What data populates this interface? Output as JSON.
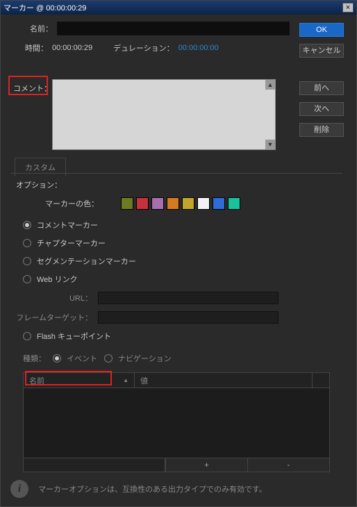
{
  "titlebar": {
    "text": "マーカー @ 00:00:00:29",
    "close": "×"
  },
  "buttons": {
    "ok": "OK",
    "cancel": "キャンセル",
    "prev": "前へ",
    "next": "次へ",
    "delete": "削除"
  },
  "fields": {
    "name_label": "名前：",
    "time_label": "時間：",
    "time_value": "00:00:00:29",
    "duration_label": "デュレーション：",
    "duration_value": "00:00:00:00",
    "comment_label": "コメント："
  },
  "tab": {
    "custom": "カスタム"
  },
  "options": {
    "header": "オプション：",
    "marker_color_label": "マーカーの色：",
    "colors": [
      "#6c7a22",
      "#c8303a",
      "#a86eb0",
      "#d67a22",
      "#c2a52a",
      "#f2f2f2",
      "#2e6cd8",
      "#18c29b"
    ],
    "types": {
      "comment": "コメントマーカー",
      "chapter": "チャプターマーカー",
      "segmentation": "セグメンテーションマーカー",
      "weblink": "Web リンク"
    },
    "url_label": "URL：",
    "frame_target_label": "フレームターゲット：",
    "flash_cue": "Flash キューポイント",
    "kind_label": "種類：",
    "kind_event": "イベント",
    "kind_nav": "ナビゲーション"
  },
  "table": {
    "col_name": "名前",
    "col_value": "値",
    "add": "+",
    "remove": "-"
  },
  "footer": {
    "info_glyph": "i",
    "note": "マーカーオプションは、互換性のある出力タイプでのみ有効です。"
  }
}
